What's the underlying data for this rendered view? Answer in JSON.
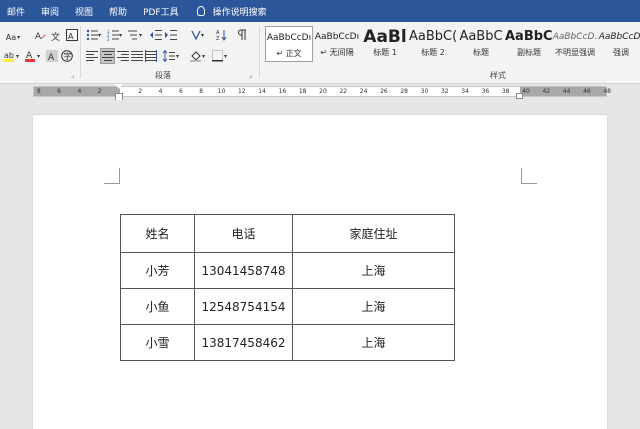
{
  "menu": {
    "items": [
      "邮件",
      "审阅",
      "视图",
      "帮助",
      "PDF工具"
    ],
    "tell_me": "操作说明搜索"
  },
  "ribbon": {
    "font_group": {
      "aa_label": "Aa",
      "dropdown_label": "▾"
    },
    "paragraph_group": {
      "label": "段落"
    },
    "styles_group": {
      "label": "样式"
    },
    "styles": [
      {
        "preview": "AaBbCcDı",
        "name": "↵ 正文",
        "font_size": "9px",
        "selected": true
      },
      {
        "preview": "AaBbCcDı",
        "name": "↵ 无间隔",
        "font_size": "9px",
        "selected": false
      },
      {
        "preview": "AaBl",
        "name": "标题 1",
        "font_size": "17px",
        "selected": false
      },
      {
        "preview": "AaBbC(",
        "name": "标题 2",
        "font_size": "13px",
        "selected": false
      },
      {
        "preview": "AaBbC",
        "name": "标题",
        "font_size": "13px",
        "selected": false
      },
      {
        "preview": "AaBbC(",
        "name": "副标题",
        "font_size": "13px",
        "selected": false
      },
      {
        "preview": "AaBbCcD.",
        "name": "不明显强调",
        "font_size": "9px",
        "selected": false
      },
      {
        "preview": "AaBbCcD.",
        "name": "强调",
        "font_size": "9px",
        "selected": false
      }
    ]
  },
  "ruler": {
    "left_numbers": [
      "8",
      "6",
      "4",
      "2"
    ],
    "right_numbers": [
      "2",
      "4",
      "6",
      "8",
      "10",
      "12",
      "14",
      "16",
      "18",
      "20",
      "22",
      "24",
      "26",
      "28",
      "30",
      "32",
      "34",
      "36",
      "38",
      "40",
      "42",
      "44",
      "46",
      "48"
    ]
  },
  "table": {
    "headers": [
      "姓名",
      "电话",
      "家庭住址"
    ],
    "rows": [
      [
        "小芳",
        "13041458748",
        "上海"
      ],
      [
        "小鱼",
        "12548754154",
        "上海"
      ],
      [
        "小雪",
        "13817458462",
        "上海"
      ]
    ]
  },
  "colors": {
    "menubar": "#2b579a",
    "ribbon": "#f3f3f3",
    "workspace": "#e6e6e6"
  }
}
